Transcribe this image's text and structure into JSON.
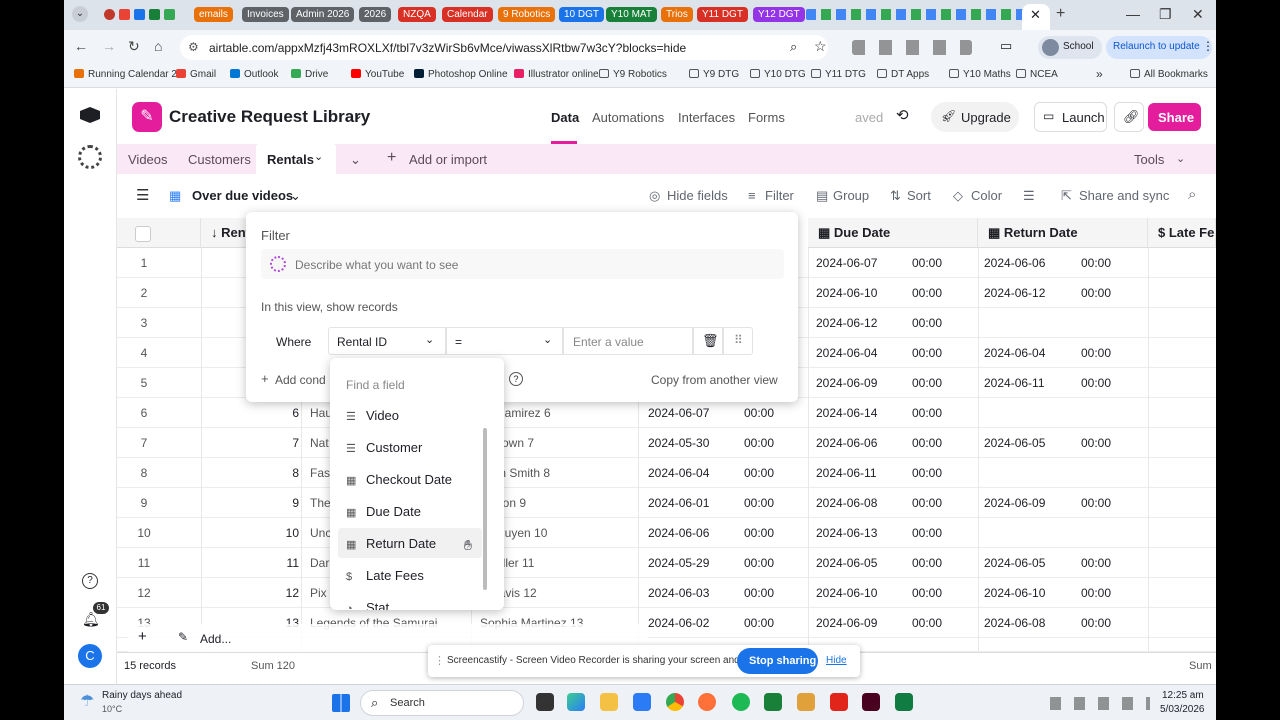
{
  "browser": {
    "tab_pills": [
      {
        "label": "emails",
        "color": "#e8710a"
      },
      {
        "label": "Invoices",
        "color": "#5f6368"
      },
      {
        "label": "Admin 2026",
        "color": "#5f6368"
      },
      {
        "label": "2026",
        "color": "#5f6368"
      },
      {
        "label": "NZQA",
        "color": "#d93025"
      },
      {
        "label": "Calendar",
        "color": "#d93025"
      },
      {
        "label": "9 Robotics",
        "color": "#e8710a"
      },
      {
        "label": "10 DGT",
        "color": "#1a73e8"
      },
      {
        "label": "Y10 MAT",
        "color": "#188038"
      },
      {
        "label": "Trios",
        "color": "#e8710a"
      },
      {
        "label": "Y11 DGT",
        "color": "#d93025"
      },
      {
        "label": "Y12 DGT",
        "color": "#9334e6"
      }
    ],
    "url": "airtable.com/appxMzfj43mROXLXf/tbl7v3zWirSb6vMce/viwassXlRtbw7w3cY?blocks=hide",
    "profile_label": "School",
    "relaunch_label": "Relaunch to update",
    "bookmarks": [
      "Running Calendar 2...",
      "Gmail",
      "Outlook",
      "Drive",
      "YouTube",
      "Photoshop Online",
      "Illustrator online",
      "Y9 Robotics",
      "Y9 DTG",
      "Y10 DTG",
      "Y11 DTG",
      "DT Apps",
      "Y10 Maths",
      "NCEA"
    ],
    "all_bookmarks_label": "All Bookmarks"
  },
  "app": {
    "base_name": "Creative Request Library",
    "nav": [
      "Data",
      "Automations",
      "Interfaces",
      "Forms"
    ],
    "saved_label": "aved",
    "upgrade_label": "Upgrade",
    "launch_label": "Launch",
    "share_label": "Share",
    "tables": [
      "Videos",
      "Customers",
      "Rentals"
    ],
    "add_import_label": "Add or import",
    "tools_label": "Tools",
    "view_name": "Over due videos",
    "view_actions": [
      "Hide fields",
      "Filter",
      "Group",
      "Sort",
      "Color",
      "Share and sync"
    ],
    "accent_color": "#e41d9c"
  },
  "grid": {
    "columns": [
      "Rent",
      "Due Date",
      "Return Date",
      "Late Fee"
    ],
    "rows": [
      {
        "n": "1",
        "id": "",
        "title": "",
        "customer": "",
        "checkout": "",
        "due": "2024-06-07",
        "due_t": "00:00",
        "ret": "2024-06-06",
        "ret_t": "00:00"
      },
      {
        "n": "2",
        "id": "",
        "title": "",
        "customer": "",
        "checkout": "",
        "due": "2024-06-10",
        "due_t": "00:00",
        "ret": "2024-06-12",
        "ret_t": "00:00"
      },
      {
        "n": "3",
        "id": "",
        "title": "",
        "customer": "",
        "checkout": "",
        "due": "2024-06-12",
        "due_t": "00:00",
        "ret": "",
        "ret_t": ""
      },
      {
        "n": "4",
        "id": "",
        "title": "",
        "customer": "",
        "checkout": "",
        "due": "2024-06-04",
        "due_t": "00:00",
        "ret": "2024-06-04",
        "ret_t": "00:00"
      },
      {
        "n": "5",
        "id": "",
        "title": "",
        "customer": "",
        "checkout": "",
        "due": "2024-06-09",
        "due_t": "00:00",
        "ret": "2024-06-11",
        "ret_t": "00:00"
      },
      {
        "n": "6",
        "id": "6",
        "title": "Hau",
        "customer": "os Ramirez 6",
        "checkout": "2024-06-07",
        "co_t": "00:00",
        "due": "2024-06-14",
        "due_t": "00:00",
        "ret": "",
        "ret_t": ""
      },
      {
        "n": "7",
        "id": "7",
        "title": "Nat",
        "customer": "a Brown 7",
        "checkout": "2024-05-30",
        "co_t": "00:00",
        "due": "2024-06-06",
        "due_t": "00:00",
        "ret": "2024-06-05",
        "ret_t": "00:00"
      },
      {
        "n": "8",
        "id": "8",
        "title": "Fas",
        "customer": "amin Smith 8",
        "checkout": "2024-06-04",
        "co_t": "00:00",
        "due": "2024-06-11",
        "due_t": "00:00",
        "ret": "",
        "ret_t": ""
      },
      {
        "n": "9",
        "id": "9",
        "title": "The",
        "customer": "Wilson 9",
        "checkout": "2024-06-01",
        "co_t": "00:00",
        "due": "2024-06-08",
        "due_t": "00:00",
        "ret": "2024-06-09",
        "ret_t": "00:00"
      },
      {
        "n": "10",
        "id": "10",
        "title": "Unc",
        "customer": "s Nguyen 10",
        "checkout": "2024-06-06",
        "co_t": "00:00",
        "due": "2024-06-13",
        "due_t": "00:00",
        "ret": "",
        "ret_t": ""
      },
      {
        "n": "11",
        "id": "11",
        "title": "Dar",
        "customer": "e Miller 11",
        "checkout": "2024-05-29",
        "co_t": "00:00",
        "due": "2024-06-05",
        "due_t": "00:00",
        "ret": "2024-06-05",
        "ret_t": "00:00"
      },
      {
        "n": "12",
        "id": "12",
        "title": "Pix",
        "customer": "n Davis 12",
        "checkout": "2024-06-03",
        "co_t": "00:00",
        "due": "2024-06-10",
        "due_t": "00:00",
        "ret": "2024-06-10",
        "ret_t": "00:00"
      },
      {
        "n": "13",
        "id": "13",
        "title": "Legends of the Samurai",
        "customer": "Sophia Martinez 13",
        "checkout": "2024-06-02",
        "co_t": "00:00",
        "due": "2024-06-09",
        "due_t": "00:00",
        "ret": "2024-06-08",
        "ret_t": "00:00"
      }
    ],
    "record_count": "15 records",
    "sum_label": "Sum 120",
    "sum_right_label": "Sum"
  },
  "filter": {
    "title": "Filter",
    "ai_placeholder": "Describe what you want to see",
    "in_view_label": "In this view, show records",
    "where_label": "Where",
    "field_selected": "Rental ID",
    "operator": "=",
    "value_placeholder": "Enter a value",
    "add_condition_label": "Add cond",
    "copy_label": "Copy from another view",
    "find_field_placeholder": "Find a field",
    "fields": [
      {
        "label": "Video",
        "icon": "long-text-icon"
      },
      {
        "label": "Customer",
        "icon": "long-text-icon"
      },
      {
        "label": "Checkout Date",
        "icon": "calendar-icon"
      },
      {
        "label": "Due Date",
        "icon": "calendar-icon"
      },
      {
        "label": "Return Date",
        "icon": "calendar-icon"
      },
      {
        "label": "Late Fees",
        "icon": "currency-icon"
      },
      {
        "label": "Stat",
        "icon": "status-icon"
      }
    ]
  },
  "screencastify": {
    "message": "Screencastify - Screen Video Recorder is sharing your screen and audio.",
    "stop_label": "Stop sharing",
    "hide_label": "Hide"
  },
  "sidebar": {
    "notif_count": "61",
    "avatar_letter": "C",
    "add_label": "Add..."
  },
  "taskbar": {
    "weather_title": "Rainy days ahead",
    "weather_temp": "10°C",
    "search_label": "Search",
    "time": "12:25 am",
    "date": "5/03/2026"
  }
}
